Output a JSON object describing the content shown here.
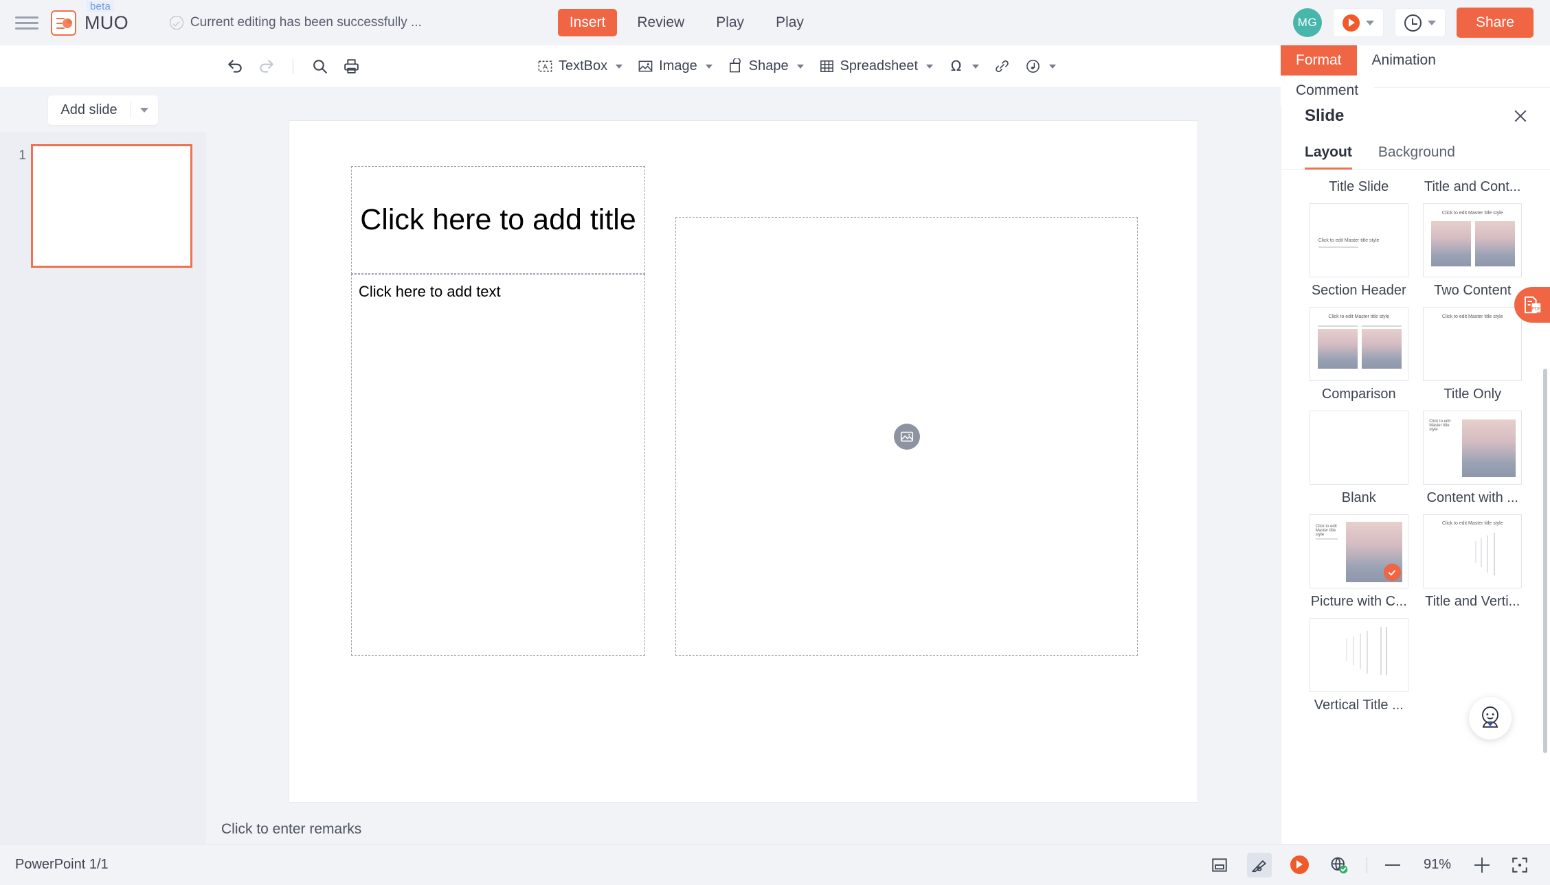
{
  "topbar": {
    "hamburger_icon": "hamburger-menu-icon",
    "logo_icon": "app-logo-icon",
    "beta_badge": "beta",
    "brand": "MUO",
    "save_status": "Current editing has been successfully ...",
    "save_status_icon": "check-circle-icon",
    "menus": [
      {
        "label": "Insert",
        "active": true
      },
      {
        "label": "Review",
        "active": false
      },
      {
        "label": "Play",
        "active": false
      },
      {
        "label": "Play",
        "active": false
      }
    ],
    "avatar_initials": "MG",
    "present_icon": "play-circle-icon",
    "history_icon": "clock-icon",
    "share_label": "Share",
    "accent_color": "#f06543"
  },
  "toolbar": {
    "undo_icon": "undo-icon",
    "redo_icon": "redo-icon",
    "search_icon": "search-icon",
    "print_icon": "print-icon",
    "groups": [
      {
        "label": "TextBox",
        "icon": "textbox-icon",
        "caret": true
      },
      {
        "label": "Image",
        "icon": "image-icon",
        "caret": true
      },
      {
        "label": "Shape",
        "icon": "shape-icon",
        "caret": true
      },
      {
        "label": "Spreadsheet",
        "icon": "table-icon",
        "caret": true
      },
      {
        "label": "",
        "icon": "omega-symbol-icon",
        "caret": true
      },
      {
        "label": "",
        "icon": "link-icon",
        "caret": false
      },
      {
        "label": "",
        "icon": "audio-icon",
        "caret": true
      }
    ]
  },
  "slide_panel": {
    "add_slide_label": "Add slide",
    "add_slide_caret_icon": "chevron-down-icon",
    "slides": [
      {
        "number": "1"
      }
    ]
  },
  "canvas": {
    "title_placeholder": "Click here to add title",
    "body_placeholder": "Click here to add text",
    "picture_placeholder_icon": "image-placeholder-icon",
    "remarks_placeholder": "Click to enter remarks"
  },
  "right_panel": {
    "outer_tabs": [
      {
        "label": "Format",
        "active": true
      },
      {
        "label": "Animation",
        "active": false
      },
      {
        "label": "Comment",
        "active": false
      }
    ],
    "title": "Slide",
    "close_icon": "close-icon",
    "tabs": [
      {
        "label": "Layout",
        "active": true
      },
      {
        "label": "Background",
        "active": false
      }
    ],
    "layouts": [
      {
        "label": "Title Slide",
        "kind": "title-slide",
        "selected": false
      },
      {
        "label": "Title and Cont...",
        "kind": "title-and-content",
        "selected": false
      },
      {
        "label": "Section Header",
        "kind": "section-header",
        "selected": false
      },
      {
        "label": "Two Content",
        "kind": "two-content",
        "selected": false
      },
      {
        "label": "Comparison",
        "kind": "comparison",
        "selected": false
      },
      {
        "label": "Title Only",
        "kind": "title-only",
        "selected": false
      },
      {
        "label": "Blank",
        "kind": "blank",
        "selected": false
      },
      {
        "label": "Content with ...",
        "kind": "content-with-caption",
        "selected": false
      },
      {
        "label": "Picture with C...",
        "kind": "picture-with-caption",
        "selected": true
      },
      {
        "label": "Title and Verti...",
        "kind": "title-and-vertical-text",
        "selected": false
      },
      {
        "label": "Vertical Title ...",
        "kind": "vertical-title-and-text",
        "selected": false
      }
    ],
    "thumb_master_title": "Click to edit Master title style",
    "pdf_button_icon": "export-pdf-icon",
    "assistant_icon": "assistant-avatar-icon"
  },
  "statusbar": {
    "doc_info": "PowerPoint 1/1",
    "view_normal_icon": "normal-view-icon",
    "view_annotate_icon": "pen-view-icon",
    "play_icon": "play-circle-icon",
    "network_icon": "network-status-icon",
    "zoom_out_icon": "zoom-out-icon",
    "zoom_level": "91%",
    "zoom_in_icon": "zoom-in-icon",
    "fit_icon": "fit-to-screen-icon"
  }
}
